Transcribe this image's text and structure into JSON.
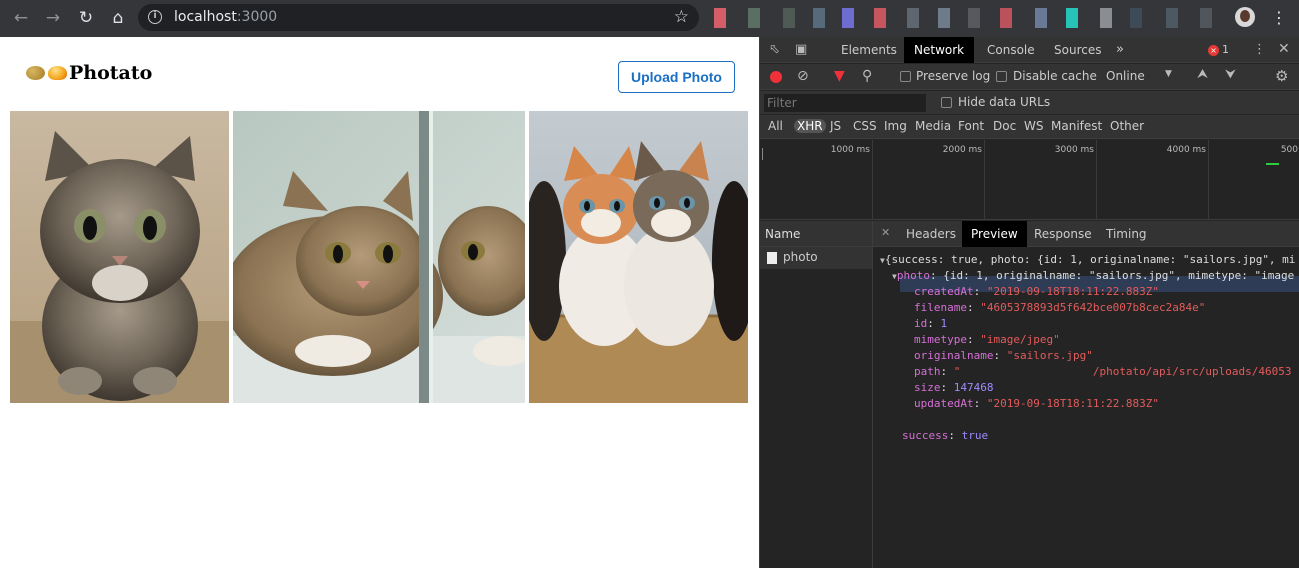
{
  "browser": {
    "url_host": "localhost",
    "url_port": ":3000"
  },
  "page": {
    "logo_text": "Photato",
    "upload_button": "Upload Photo",
    "photos": [
      {
        "alt": "tabby kitten"
      },
      {
        "alt": "kitten reflection"
      },
      {
        "alt": "two kittens"
      }
    ]
  },
  "devtools": {
    "tabs": [
      "Elements",
      "Network",
      "Console",
      "Sources"
    ],
    "active_tab": "Network",
    "error_count": "1",
    "toolbar": {
      "preserve_log": "Preserve log",
      "disable_cache": "Disable cache",
      "throttle": "Online"
    },
    "filter": {
      "placeholder": "Filter",
      "hide_data_urls": "Hide data URLs"
    },
    "types": [
      "All",
      "XHR",
      "JS",
      "CSS",
      "Img",
      "Media",
      "Font",
      "Doc",
      "WS",
      "Manifest",
      "Other"
    ],
    "selected_type": "XHR",
    "timeline_ticks": [
      "1000 ms",
      "2000 ms",
      "3000 ms",
      "4000 ms",
      "500"
    ],
    "name_header": "Name",
    "requests": [
      "photo"
    ],
    "detail_tabs": [
      "Headers",
      "Preview",
      "Response",
      "Timing"
    ],
    "active_detail_tab": "Preview",
    "preview": {
      "root": "{success: true, photo: {id: 1, originalname: \"sailors.jpg\", mi",
      "photo_key": "photo",
      "photo_summary": ": {id: 1, originalname: \"sailors.jpg\", mimetype: \"image",
      "fields": [
        {
          "key": "createdAt",
          "value": "\"2019-09-18T18:11:22.883Z\"",
          "kind": "string"
        },
        {
          "key": "filename",
          "value": "\"4605378893d5f642bce007b8cec2a84e\"",
          "kind": "string"
        },
        {
          "key": "id",
          "value": "1",
          "kind": "number"
        },
        {
          "key": "mimetype",
          "value": "\"image/jpeg\"",
          "kind": "string"
        },
        {
          "key": "originalname",
          "value": "\"sailors.jpg\"",
          "kind": "string"
        },
        {
          "key": "path",
          "value": "\"                    /photato/api/src/uploads/46053",
          "kind": "string"
        },
        {
          "key": "size",
          "value": "147468",
          "kind": "number"
        },
        {
          "key": "updatedAt",
          "value": "\"2019-09-18T18:11:22.883Z\"",
          "kind": "string"
        }
      ],
      "success_key": "success",
      "success_value": "true"
    }
  }
}
